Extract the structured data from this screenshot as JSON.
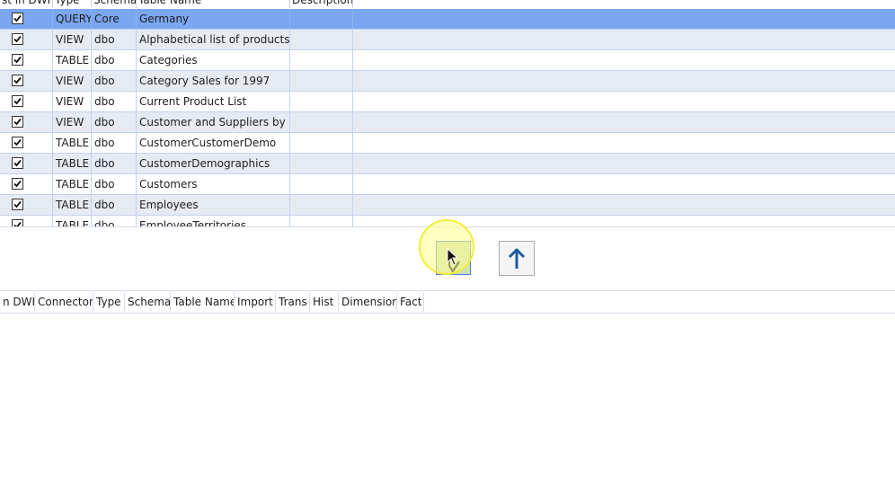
{
  "top_grid": {
    "headers": [
      "st in DWH",
      "Type",
      "Schema",
      "Table Name",
      "Description"
    ],
    "rows": [
      {
        "checked": true,
        "type": "QUERY",
        "schema": "Core",
        "table_name": "Germany",
        "description": ""
      },
      {
        "checked": true,
        "type": "VIEW",
        "schema": "dbo",
        "table_name": "Alphabetical list of products",
        "description": ""
      },
      {
        "checked": true,
        "type": "TABLE",
        "schema": "dbo",
        "table_name": "Categories",
        "description": ""
      },
      {
        "checked": true,
        "type": "VIEW",
        "schema": "dbo",
        "table_name": "Category Sales for 1997",
        "description": ""
      },
      {
        "checked": true,
        "type": "VIEW",
        "schema": "dbo",
        "table_name": "Current Product List",
        "description": ""
      },
      {
        "checked": true,
        "type": "VIEW",
        "schema": "dbo",
        "table_name": "Customer and Suppliers by City",
        "description": ""
      },
      {
        "checked": true,
        "type": "TABLE",
        "schema": "dbo",
        "table_name": "CustomerCustomerDemo",
        "description": ""
      },
      {
        "checked": true,
        "type": "TABLE",
        "schema": "dbo",
        "table_name": "CustomerDemographics",
        "description": ""
      },
      {
        "checked": true,
        "type": "TABLE",
        "schema": "dbo",
        "table_name": "Customers",
        "description": ""
      },
      {
        "checked": true,
        "type": "TABLE",
        "schema": "dbo",
        "table_name": "Employees",
        "description": ""
      },
      {
        "checked": true,
        "type": "TABLE",
        "schema": "dbo",
        "table_name": "EmployeeTerritories",
        "description": ""
      }
    ]
  },
  "buttons": {
    "move_down_icon": "arrow-down-check-icon",
    "move_up_icon": "arrow-up-icon"
  },
  "bottom_grid": {
    "headers": [
      "n DWH",
      "Connector",
      "Type",
      "Schema",
      "Table Name",
      "Import",
      "Trans",
      "Hist",
      "Dimension",
      "Fact"
    ]
  },
  "colors": {
    "selected_row": "#7aa6f2",
    "alt_row": "#e6eaf3",
    "grid_line": "#c3d2ec",
    "up_arrow": "#1e5aa0",
    "highlight": "#fff68c"
  }
}
